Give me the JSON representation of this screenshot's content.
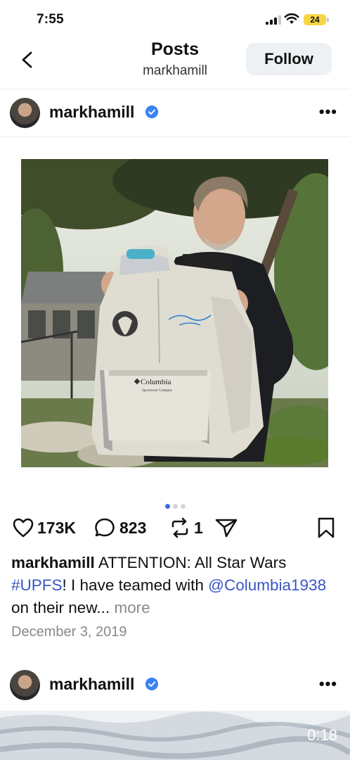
{
  "status_bar": {
    "time": "7:55",
    "battery": "24"
  },
  "header": {
    "title": "Posts",
    "subtitle": "markhamill",
    "follow_label": "Follow"
  },
  "post": {
    "username": "markhamill",
    "image": {
      "jacket_brand": "Columbia",
      "jacket_brand_sub": "Sportswear Company"
    },
    "carousel": {
      "count": 3,
      "active": 1
    },
    "likes": "173K",
    "comments": "823",
    "reposts": "1",
    "caption": {
      "username": "markhamill",
      "text1": " ATTENTION: All Star Wars ",
      "hashtag": "#UPFS",
      "text2": "! I have teamed with ",
      "mention": "@Columbia1938",
      "text3": " on their new... ",
      "more": "more"
    },
    "date": "December 3, 2019"
  },
  "next_post": {
    "username": "markhamill",
    "video_duration": "0:18"
  },
  "colors": {
    "accent": "#3b82f6",
    "link": "#3a55c5",
    "muted": "#8a8a8a"
  }
}
